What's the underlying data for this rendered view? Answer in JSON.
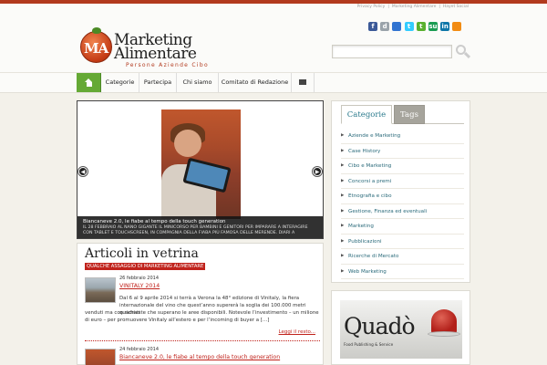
{
  "site": {
    "top_links": [
      "Privacy Policy",
      "|",
      "Marketing Alimentare",
      "|",
      "Hayet Social"
    ],
    "logo_badge": "MA",
    "logo_line1": "Marketing",
    "logo_line2": "Alimentare",
    "logo_tagline": "Persone Aziende Cibo",
    "search": {
      "placeholder": ""
    }
  },
  "social_icons": [
    {
      "name": "facebook-icon",
      "glyph": "f",
      "color": "#3b5998"
    },
    {
      "name": "digg-icon",
      "glyph": "d",
      "color": "#9aa3aa"
    },
    {
      "name": "delicious-icon",
      "glyph": "",
      "color": "#3274d1"
    },
    {
      "name": "twitter-icon",
      "glyph": "t",
      "color": "#33ccff"
    },
    {
      "name": "technorati-icon",
      "glyph": "t",
      "color": "#59b02f"
    },
    {
      "name": "stumbleupon-icon",
      "glyph": "su",
      "color": "#1a9c52"
    },
    {
      "name": "linkedin-icon",
      "glyph": "in",
      "color": "#0e76a8"
    },
    {
      "name": "rss-icon",
      "glyph": "",
      "color": "#f28c14"
    }
  ],
  "nav": {
    "items": [
      "Categorie",
      "Partecipa",
      "Chi siamo",
      "Comitato di Redazione"
    ]
  },
  "slider": {
    "title": "Biancaneve 2.0, le fiabe al tempo della touch generation",
    "description": "IL 28 FEBBRAIO AL NANO GIGANTE IL MINICORSO PER BAMBINI E GENITORI PER IMPARARE A INTERAGIRE CON TABLET E TOUCHSCREEN, IN COMPAGNIA DELLA FIABA PIÙ FAMOSA DELLE MERENDE. DIARI A"
  },
  "articles": {
    "title": "Articoli in vetrina",
    "subtitle": "QUALCHE ASSAGGIO DI MARKETING ALIMENTARE",
    "posts": [
      {
        "date": "26 febbraio 2014",
        "title": "VINITALY 2014",
        "excerpt_line1": "Dal 6 al 9 aprile 2014 si terrà a Verona la 48° edizione di Vinitaly, la fiera",
        "excerpt_line2": "internazionale del vino che quest’anno supererà la soglia dei 100.000 metri quadrati",
        "excerpt_rest": "venduti ma con richieste che superano le aree disponibili. Notevole l’investimento – un milione di euro – per promuovere Vinitaly all’estero e per l’incoming di buyer a […]",
        "read_more": "Leggi il resto..."
      },
      {
        "date": "24 febbraio 2014",
        "title": "Biancaneve 2.0, le fiabe al tempo della touch generation"
      }
    ]
  },
  "sidebar": {
    "tabs": [
      "Categorie",
      "Tags"
    ],
    "categories": [
      "Aziende e Marketing",
      "Case History",
      "Cibo e Marketing",
      "Concorsi a premi",
      "Etnografia e cibo",
      "Gestione, Finanza ed eventuali",
      "Marketing",
      "Pubblicazioni",
      "Ricerche di Mercato",
      "Web Marketing"
    ]
  },
  "ad": {
    "logo": "Quadò",
    "tagline": "Food Publishing & Service"
  },
  "colors": {
    "brand_red": "#c0221b",
    "nav_home_green": "#65a935",
    "link_teal": "#2a6a7a"
  }
}
